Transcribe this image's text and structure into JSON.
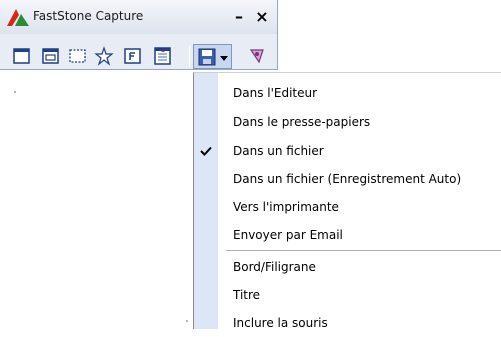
{
  "app": {
    "title": "FastStone Capture",
    "minimize_symbol": "–",
    "close_symbol": "×"
  },
  "toolbar": {
    "tools": [
      {
        "name": "capture-active-window-icon"
      },
      {
        "name": "capture-window-object-icon"
      },
      {
        "name": "capture-rectangle-icon"
      },
      {
        "name": "capture-freehand-icon"
      },
      {
        "name": "capture-full-screen-icon"
      },
      {
        "name": "capture-scrolling-window-icon"
      }
    ],
    "output_button_icon": "floppy-disk-icon",
    "settings_icon": "settings-icon"
  },
  "menu": {
    "items": [
      {
        "label": "Dans l'Editeur",
        "checked": false
      },
      {
        "label": "Dans le presse-papiers",
        "checked": false
      },
      {
        "label": "Dans un fichier",
        "checked": true
      },
      {
        "label": "Dans un fichier (Enregistrement Auto)",
        "checked": false
      },
      {
        "label": "Vers l'imprimante",
        "checked": false
      },
      {
        "label": "Envoyer par Email",
        "checked": false
      },
      {
        "label": "Bord/Filigrane",
        "checked": false
      },
      {
        "label": "Titre",
        "checked": false
      },
      {
        "label": "Inclure la souris",
        "checked": false
      }
    ]
  },
  "colors": {
    "accent": "#3a5fb0",
    "menu_gutter": "#dce6f7",
    "toolbar_bg": "#e8ecf4"
  }
}
